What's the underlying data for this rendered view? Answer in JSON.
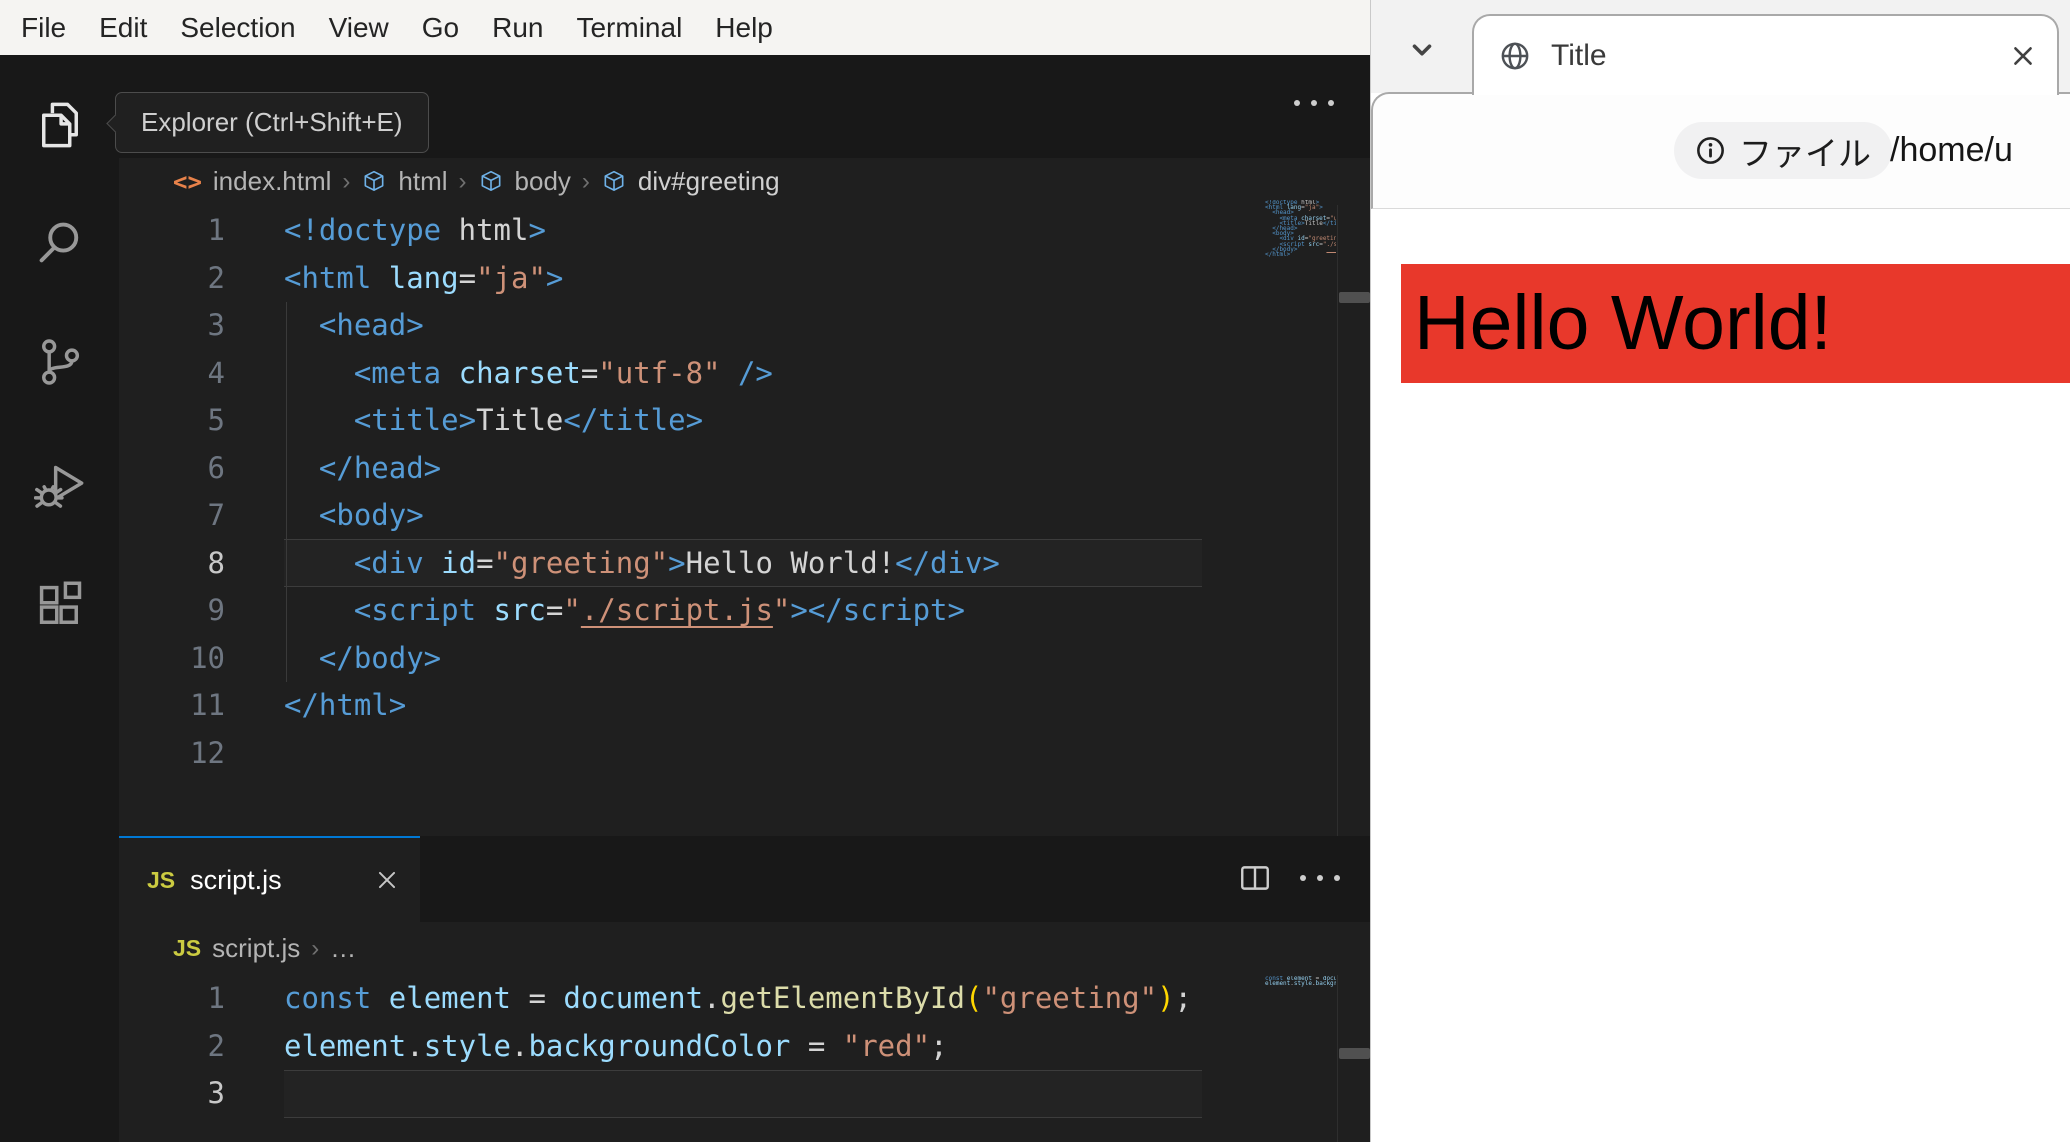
{
  "menu_bar": {
    "items": [
      "File",
      "Edit",
      "Selection",
      "View",
      "Go",
      "Run",
      "Terminal",
      "Help"
    ]
  },
  "activity_bar": {
    "tooltip": "Explorer (Ctrl+Shift+E)",
    "items": [
      {
        "name": "explorer"
      },
      {
        "name": "search"
      },
      {
        "name": "source-control"
      },
      {
        "name": "run-and-debug"
      },
      {
        "name": "extensions"
      }
    ]
  },
  "editor_html": {
    "breadcrumb": {
      "file_icon": "<>",
      "file": "index.html",
      "separator": "›",
      "segments": [
        "html",
        "body",
        "div#greeting"
      ]
    },
    "active_line": 8,
    "lines": [
      [
        [
          "<!doctype ",
          "tag"
        ],
        [
          "html",
          "txt"
        ],
        [
          ">",
          "tag"
        ]
      ],
      [
        [
          "<html ",
          "tag"
        ],
        [
          "lang",
          "attr"
        ],
        [
          "=",
          "txt"
        ],
        [
          "\"ja\"",
          "str"
        ],
        [
          ">",
          "tag"
        ]
      ],
      [
        [
          "  <head>",
          "tag"
        ]
      ],
      [
        [
          "    <meta ",
          "tag"
        ],
        [
          "charset",
          "attr"
        ],
        [
          "=",
          "txt"
        ],
        [
          "\"utf-8\"",
          "str"
        ],
        [
          " />",
          "tag"
        ]
      ],
      [
        [
          "    <title>",
          "tag"
        ],
        [
          "Title",
          "txt"
        ],
        [
          "</title>",
          "tag"
        ]
      ],
      [
        [
          "  </head>",
          "tag"
        ]
      ],
      [
        [
          "  <body>",
          "tag"
        ]
      ],
      [
        [
          "    <div ",
          "tag"
        ],
        [
          "id",
          "attr"
        ],
        [
          "=",
          "txt"
        ],
        [
          "\"greeting\"",
          "str"
        ],
        [
          ">",
          "tag"
        ],
        [
          "Hello World!",
          "txt"
        ],
        [
          "</div>",
          "tag"
        ]
      ],
      [
        [
          "    <script ",
          "tag"
        ],
        [
          "src",
          "attr"
        ],
        [
          "=",
          "txt"
        ],
        [
          "\"",
          "str"
        ],
        [
          "./script.js",
          "link"
        ],
        [
          "\"",
          "str"
        ],
        [
          "></script>",
          "tag"
        ]
      ],
      [
        [
          "  </body>",
          "tag"
        ]
      ],
      [
        [
          "</html>",
          "tag"
        ]
      ],
      []
    ]
  },
  "editor_js": {
    "tab": {
      "icon_text": "JS",
      "label": "script.js"
    },
    "breadcrumb": {
      "icon_text": "JS",
      "file": "script.js",
      "separator": "›",
      "more": "…"
    },
    "active_line": 3,
    "lines": [
      [
        [
          "const",
          "kw"
        ],
        [
          " ",
          "txt"
        ],
        [
          "element",
          "var"
        ],
        [
          " = ",
          "txt"
        ],
        [
          "document",
          "var"
        ],
        [
          ".",
          "txt"
        ],
        [
          "getElementById",
          "fn"
        ],
        [
          "(",
          "brk"
        ],
        [
          "\"greeting\"",
          "str"
        ],
        [
          ")",
          "brk"
        ],
        [
          ";",
          "txt"
        ]
      ],
      [
        [
          "element",
          "var"
        ],
        [
          ".",
          "txt"
        ],
        [
          "style",
          "var"
        ],
        [
          ".",
          "txt"
        ],
        [
          "backgroundColor",
          "var"
        ],
        [
          " = ",
          "txt"
        ],
        [
          "\"red\"",
          "str"
        ],
        [
          ";",
          "txt"
        ]
      ],
      []
    ]
  },
  "browser": {
    "tab": {
      "title": "Title"
    },
    "toolbar": {
      "chip_label": "ファイル",
      "url": "/home/u"
    },
    "page": {
      "heading": "Hello World!"
    }
  },
  "colors": {
    "accent": "#0078d4",
    "banner_red": "#e8382b",
    "js_icon": "#cbcb41",
    "html_icon": "#e8824a",
    "breadcrumb_cube": "#6fb2e8",
    "syntax": {
      "tag": "#569cd6",
      "attr": "#9cdcfe",
      "str": "#ce9178",
      "txt": "#d4d4d4",
      "link": "#ce9178",
      "kw": "#569cd6",
      "var": "#9cdcfe",
      "fn": "#dcdcaa",
      "brk": "#ffd700"
    }
  }
}
